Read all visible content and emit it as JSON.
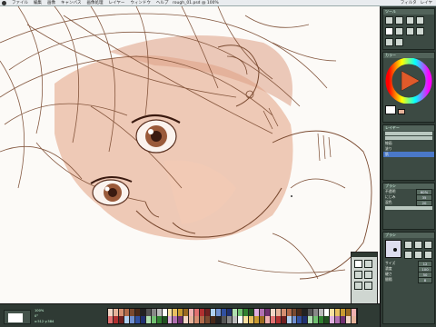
{
  "menubar": {
    "items": [
      "ファイル",
      "編集",
      "画像",
      "キャンバス",
      "画像処理",
      "レイヤー",
      "ウィンドウ",
      "ヘルプ"
    ],
    "right_items": [
      "フィルタ",
      "レイヤ"
    ],
    "document_title": "rough_01.psd @ 100%"
  },
  "palette": {
    "tools_title": "ツール",
    "color_title": "カラー",
    "layer_title": "レイヤー",
    "layer_items": [
      "線画",
      "塗り",
      "肌"
    ],
    "layer_selected": "肌",
    "brush_title": "ブラシ",
    "brush_rows": [
      {
        "label": "サイズ",
        "value": "12"
      },
      {
        "label": "濃度",
        "value": "100"
      },
      {
        "label": "硬さ",
        "value": "50"
      },
      {
        "label": "間隔",
        "value": "8"
      }
    ],
    "tool_rows": [
      {
        "label": "不透明",
        "value": "60%"
      },
      {
        "label": "にじみ",
        "value": "35"
      },
      {
        "label": "混色",
        "value": "20"
      }
    ]
  },
  "bottombar": {
    "zoom_label": "100%",
    "rotate_label": "0°",
    "status": "x:512 y:384"
  },
  "accent_colors": {
    "palette_bg": "#2f3a34",
    "panel_bg": "#3c4a43",
    "skin": "#e6b39a",
    "line": "#7a4a30"
  }
}
